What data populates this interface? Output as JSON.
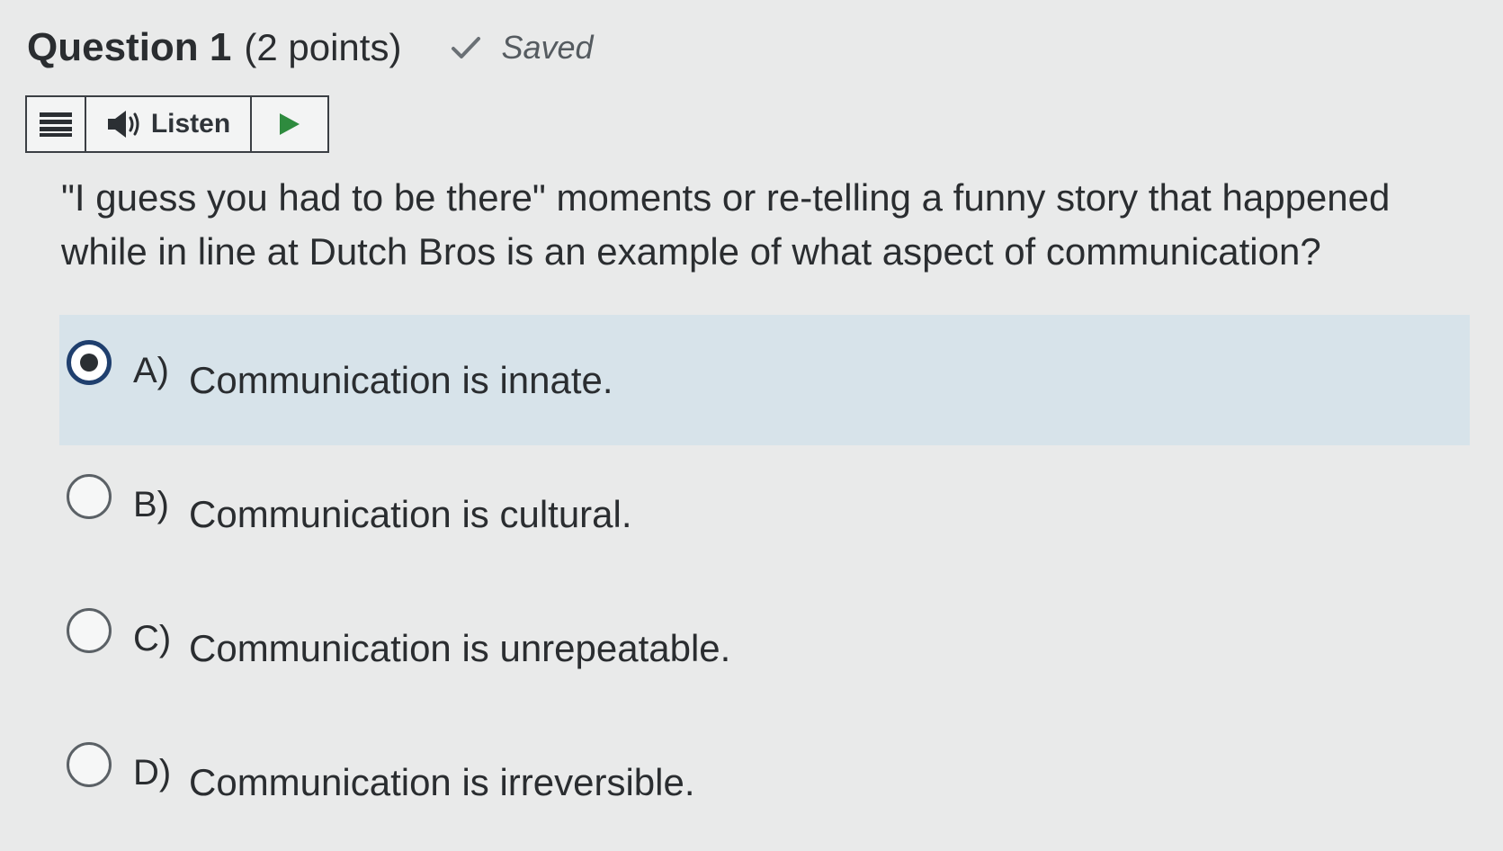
{
  "question": {
    "title": "Question 1",
    "points": "(2 points)",
    "status": "Saved",
    "prompt": "\"I guess you had to be there\" moments or re-telling a funny story that happened while in line at Dutch Bros is an example of what aspect of communication?"
  },
  "toolbar": {
    "listen_label": "Listen"
  },
  "options": [
    {
      "letter": "A)",
      "text": "Communication is innate.",
      "selected": true
    },
    {
      "letter": "B)",
      "text": "Communication is cultural.",
      "selected": false
    },
    {
      "letter": "C)",
      "text": "Communication is unrepeatable.",
      "selected": false
    },
    {
      "letter": "D)",
      "text": "Communication is irreversible.",
      "selected": false
    }
  ],
  "colors": {
    "selected_bg": "#d7e3ea",
    "radio_checked": "#1f3f6e",
    "play_green": "#2e8b3e"
  },
  "icons": {
    "status": "checkmark-icon",
    "menu": "menu-icon",
    "speaker": "speaker-icon",
    "play": "play-icon"
  }
}
